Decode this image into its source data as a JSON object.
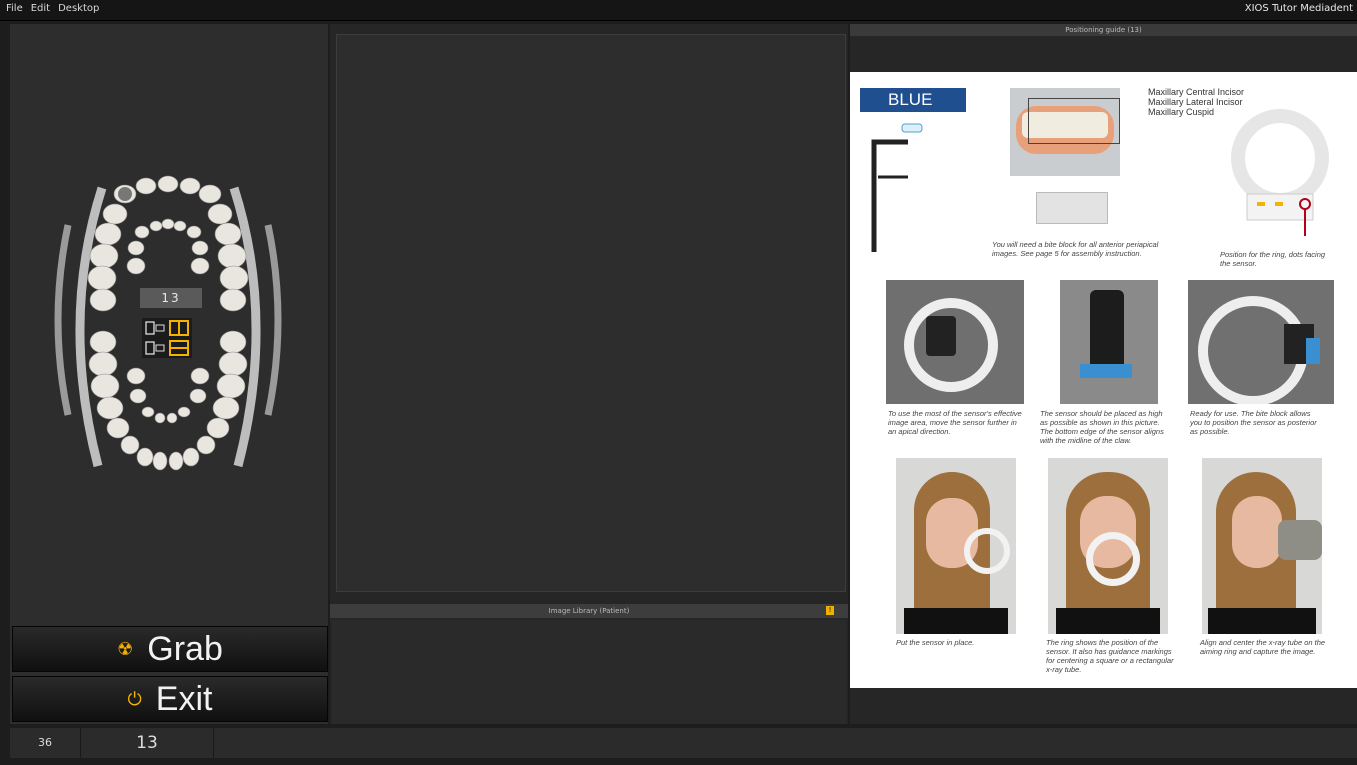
{
  "menu": {
    "items": [
      "File",
      "Edit",
      "Desktop"
    ],
    "app_title": "XIOS Tutor Mediadent"
  },
  "left_panel": {
    "selected_tooth": "13",
    "grab_label": "Grab",
    "exit_label": "Exit"
  },
  "center": {
    "library_title": "Image Library (Patient)",
    "library_warning": "!"
  },
  "guide": {
    "title": "Positioning guide (13)",
    "color_label": "BLUE",
    "teeth": [
      "Maxillary Central Incisor",
      "Maxillary Lateral Incisor",
      "Maxillary Cuspid"
    ],
    "bite_block_caption": "You will need a bite block for all anterior periapical images. See page 5 for assembly instruction.",
    "ring_caption": "Position for the ring, dots facing the sensor.",
    "step1": "To use the most of the sensor's effective image area, move the sensor further in an apical direction.",
    "step2": "The sensor should be placed as high as possible as shown in this picture. The bottom edge of the sensor aligns with the midline of the claw.",
    "step3": "Ready for use. The bite block allows you to position the sensor as posterior as possible.",
    "step4": "Put the sensor in place.",
    "step5": "The ring shows the position of the sensor. It also has guidance markings for centering a square or a rectangular x-ray tube.",
    "step6": "Align and center the x-ray tube on the aiming ring and capture the image."
  },
  "status": {
    "left_value": "36",
    "tooth_value": "13"
  },
  "colors": {
    "accent": "#f5b200",
    "badge_blue": "#1f4f8f"
  }
}
